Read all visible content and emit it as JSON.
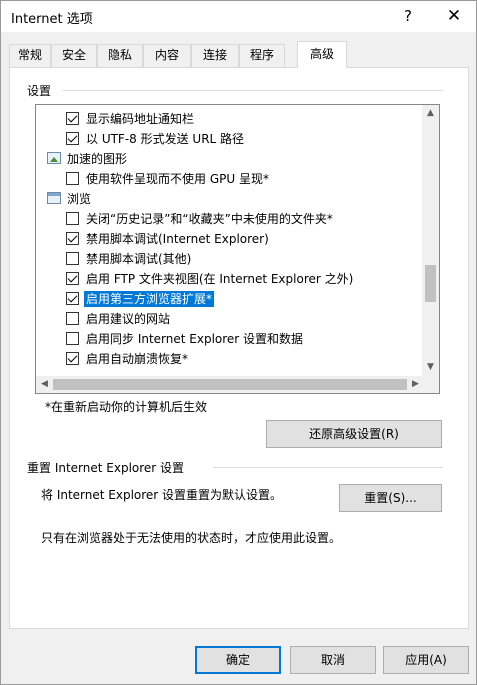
{
  "window": {
    "title": "Internet 选项",
    "help_glyph": "?",
    "close_glyph": "✕"
  },
  "tabs": [
    {
      "label": "常规"
    },
    {
      "label": "安全"
    },
    {
      "label": "隐私"
    },
    {
      "label": "内容"
    },
    {
      "label": "连接"
    },
    {
      "label": "程序"
    },
    {
      "label": "高级",
      "active": true
    }
  ],
  "settings": {
    "group_label": "设置",
    "items": [
      {
        "type": "checkbox",
        "checked": true,
        "label": "显示编码地址通知栏"
      },
      {
        "type": "checkbox",
        "checked": true,
        "label": "以 UTF-8 形式发送 URL 路径"
      },
      {
        "type": "category",
        "icon": "image-icon",
        "label": "加速的图形"
      },
      {
        "type": "checkbox",
        "checked": false,
        "label": "使用软件呈现而不使用 GPU 呈现*"
      },
      {
        "type": "category",
        "icon": "browser-window-icon",
        "label": "浏览"
      },
      {
        "type": "checkbox",
        "checked": false,
        "label": "关闭“历史记录”和“收藏夹”中未使用的文件夹*"
      },
      {
        "type": "checkbox",
        "checked": true,
        "label": "禁用脚本调试(Internet Explorer)"
      },
      {
        "type": "checkbox",
        "checked": false,
        "label": "禁用脚本调试(其他)"
      },
      {
        "type": "checkbox",
        "checked": true,
        "label": "启用 FTP 文件夹视图(在 Internet Explorer 之外)"
      },
      {
        "type": "checkbox",
        "checked": true,
        "label": "启用第三方浏览器扩展*",
        "selected": true
      },
      {
        "type": "checkbox",
        "checked": false,
        "label": "启用建议的网站"
      },
      {
        "type": "checkbox",
        "checked": false,
        "label": "启用同步 Internet Explorer 设置和数据"
      },
      {
        "type": "checkbox",
        "checked": true,
        "label": "启用自动崩溃恢复*"
      }
    ],
    "scroll_up_glyph": "▲",
    "scroll_down_glyph": "▼",
    "scroll_left_glyph": "◀",
    "scroll_right_glyph": "▶",
    "restart_note": "*在重新启动你的计算机后生效",
    "restore_button": "还原高级设置(R)"
  },
  "reset": {
    "group_label": "重置 Internet Explorer 设置",
    "description": "将 Internet Explorer 设置重置为默认设置。",
    "reset_button": "重置(S)...",
    "warning": "只有在浏览器处于无法使用的状态时，才应使用此设置。"
  },
  "footer": {
    "ok_button": "确定",
    "cancel_button": "取消",
    "apply_button": "应用(A)"
  },
  "colors": {
    "selection": "#0078d7",
    "default_button_border": "#0078d7"
  }
}
